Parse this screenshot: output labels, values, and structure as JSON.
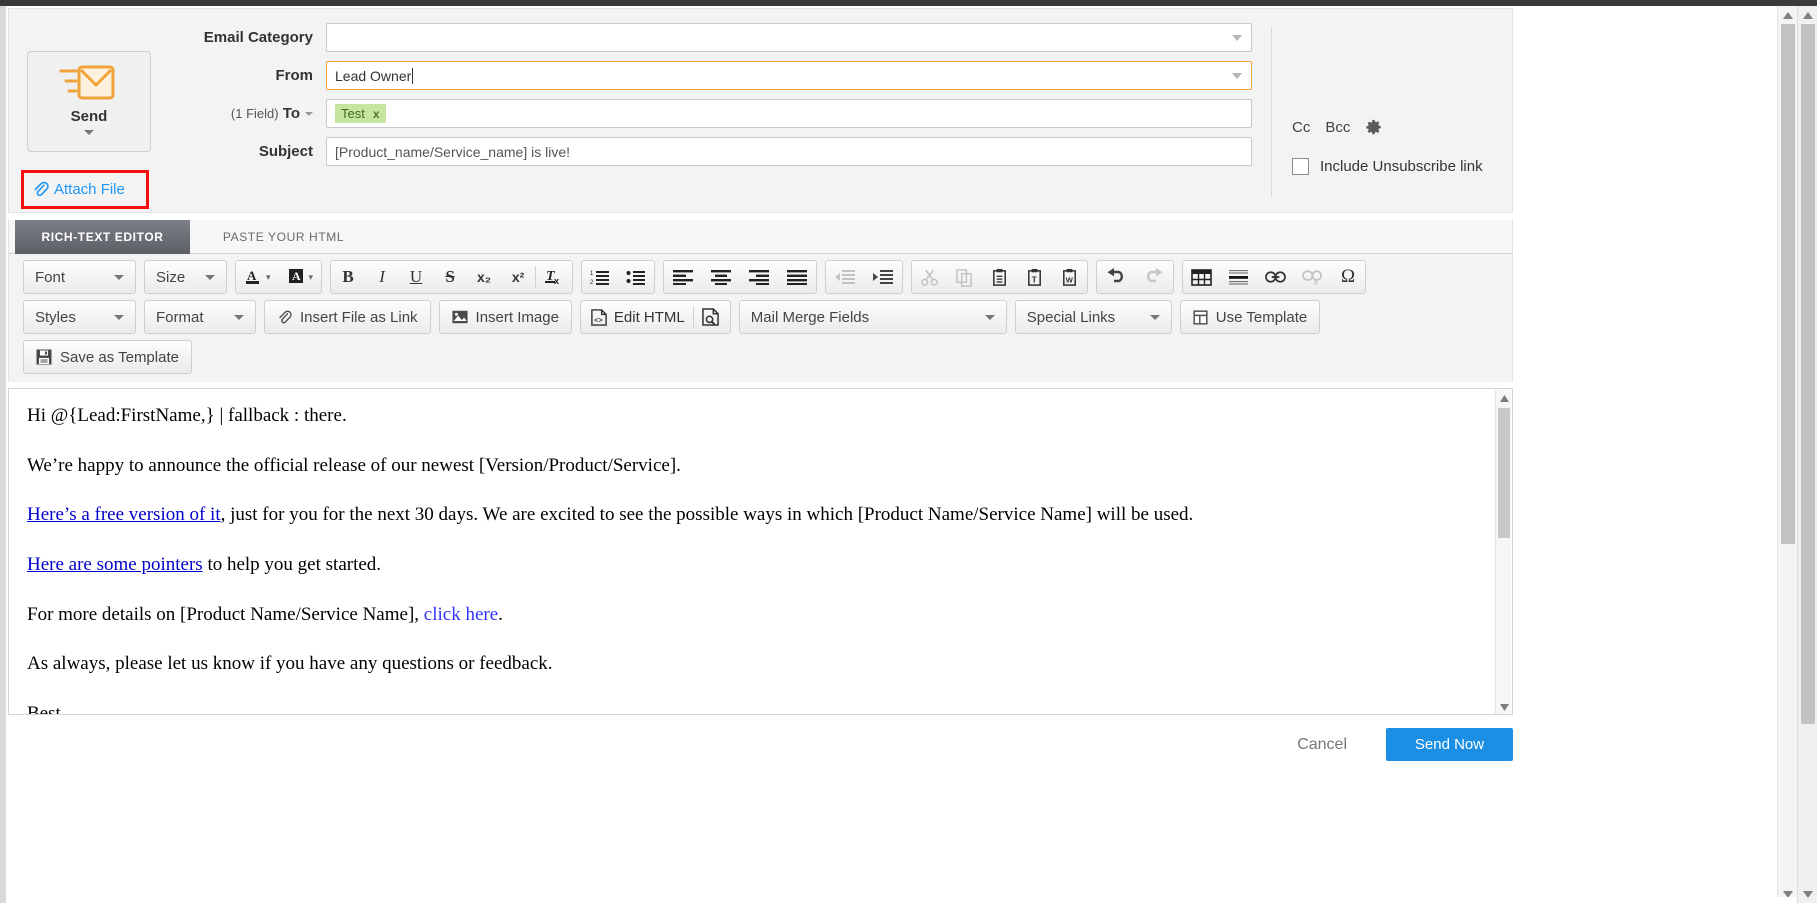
{
  "send_panel": {
    "button_label": "Send",
    "icon": "send-envelope-icon",
    "dropdown_caret": "caret-down-icon",
    "attach_label": "Attach File",
    "attach_icon": "paperclip-icon",
    "highlight_color": "#f60f0f"
  },
  "form": {
    "rows": [
      {
        "label": "Email Category",
        "value": "",
        "placeholder": "",
        "type": "select"
      },
      {
        "label": "From",
        "value": "Lead Owner",
        "placeholder": "",
        "type": "select"
      },
      {
        "label": "To",
        "prefix": "(1 Field)",
        "value": "",
        "placeholder": "",
        "type": "tags"
      },
      {
        "label": "Subject",
        "value": "[Product_name/Service_name] is live!",
        "placeholder": "",
        "type": "text"
      }
    ],
    "to_tags": [
      {
        "text": "Test",
        "remove": "x"
      }
    ]
  },
  "right_panel": {
    "cc_label": "Cc",
    "bcc_label": "Bcc",
    "gear_icon": "gear-icon",
    "unsubscribe_label": "Include Unsubscribe link",
    "unsubscribe_checked": false
  },
  "tabs": [
    {
      "label": "RICH-TEXT EDITOR",
      "active": true
    },
    {
      "label": "PASTE YOUR HTML",
      "active": false
    }
  ],
  "toolbar": {
    "row1": {
      "font_dropdown": "Font",
      "size_dropdown": "Size",
      "text_color_icon": "text-color-icon",
      "bg_color_icon": "background-color-icon",
      "bold": "B",
      "italic": "I",
      "underline": "U",
      "strikethrough": "S",
      "subscript": "x₂",
      "superscript": "x²",
      "remove_format": "remove-format-icon",
      "numbered_list": "numbered-list-icon",
      "bulleted_list": "bulleted-list-icon",
      "align_left": "align-left-icon",
      "align_center": "align-center-icon",
      "align_right": "align-right-icon",
      "align_justify": "align-justify-icon",
      "outdent": "outdent-icon",
      "indent": "indent-icon",
      "cut": "cut-icon",
      "copy": "copy-icon",
      "paste": "paste-icon",
      "paste_text": "paste-as-text-icon",
      "paste_word": "paste-from-word-icon",
      "undo": "undo-icon",
      "redo": "redo-icon",
      "table": "table-icon",
      "horizontal_rule": "horizontal-rule-icon",
      "link": "link-icon",
      "unlink": "unlink-icon",
      "special_char": "Ω"
    },
    "row2": {
      "styles_dropdown": "Styles",
      "format_dropdown": "Format",
      "insert_file_as_link": "Insert File as Link",
      "insert_image": "Insert Image",
      "edit_html": "Edit HTML",
      "preview": "preview-icon",
      "mail_merge_fields": "Mail Merge Fields",
      "special_links": "Special Links",
      "use_template": "Use Template"
    },
    "row3": {
      "save_as_template": "Save as Template"
    }
  },
  "body": {
    "paragraphs": [
      {
        "segments": [
          {
            "text": "Hi @{Lead:FirstName,} | fallback : there.",
            "style": "plain"
          }
        ]
      },
      {
        "segments": [
          {
            "text": "We’re happy to announce the official release of our newest [Version/Product/Service].",
            "style": "plain"
          }
        ]
      },
      {
        "segments": [
          {
            "text": "Here’s a free version of it",
            "style": "link"
          },
          {
            "text": ", just for you for the next 30 days. We are excited to see the possible ways in which [Product Name/Service Name] will be used.",
            "style": "plain"
          }
        ]
      },
      {
        "segments": [
          {
            "text": "Here are some pointers",
            "style": "link"
          },
          {
            "text": " to help you get started.",
            "style": "plain"
          }
        ]
      },
      {
        "segments": [
          {
            "text": "For more details on [Product Name/Service Name], ",
            "style": "plain"
          },
          {
            "text": "click here",
            "style": "link-plain"
          },
          {
            "text": ".",
            "style": "plain"
          }
        ]
      },
      {
        "segments": [
          {
            "text": "As always, please let us know if you have any questions or feedback.",
            "style": "plain"
          }
        ]
      },
      {
        "segments": [
          {
            "text": "Best,",
            "style": "plain"
          }
        ]
      }
    ]
  },
  "footer": {
    "cancel_label": "Cancel",
    "send_now_label": "Send Now",
    "send_now_color": "#1a8fe3"
  }
}
